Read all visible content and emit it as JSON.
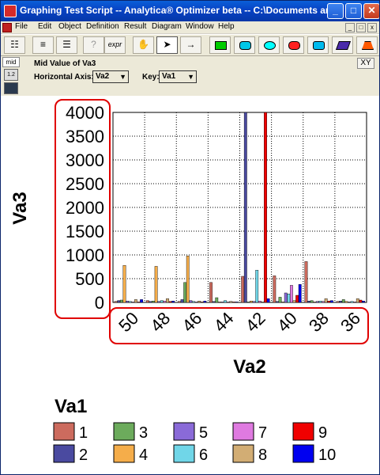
{
  "window": {
    "title": "Graphing Test Script -- Analytica® Optimizer beta -- C:\\Documents and Set...",
    "minimize_glyph": "_",
    "maximize_glyph": "□",
    "close_glyph": "✕"
  },
  "menu": {
    "items": [
      "File",
      "Edit",
      "Object",
      "Definition",
      "Result",
      "Diagram",
      "Window",
      "Help"
    ],
    "mdi_min": "_",
    "mdi_max": "□",
    "mdi_close": "x"
  },
  "toolbar": {
    "expr_label": "expr",
    "shape_colors": [
      "#00cc00",
      "#00c8e8",
      "#00ffff",
      "#ff2020",
      "#00bbee",
      "#4a2aaa",
      "#ff5a00"
    ]
  },
  "side": {
    "mid_label": "mid",
    "icon_table_label": "1.2",
    "icon_chart_label": "graph"
  },
  "controls": {
    "title": "Mid Value of Va3",
    "horizontal_axis_label": "Horizontal Axis:",
    "horizontal_axis_value": "Va2",
    "key_label": "Key:",
    "key_value": "Va1",
    "xy_label": "XY"
  },
  "chart_data": {
    "type": "bar",
    "ylabel": "Va3",
    "xlabel": "Va2",
    "ylim": [
      0,
      4000
    ],
    "yticks": [
      0,
      500,
      1000,
      1500,
      2000,
      2500,
      3000,
      3500,
      4000
    ],
    "categories": [
      "50",
      "48",
      "46",
      "44",
      "42",
      "40",
      "38",
      "36"
    ],
    "legend_title": "Va1",
    "grid": true,
    "annotation_color": "#e00000",
    "series": [
      {
        "name": "1",
        "color": "#cc6b5e",
        "values": [
          20,
          40,
          20,
          420,
          550,
          560,
          860,
          20
        ]
      },
      {
        "name": "2",
        "color": "#4a4aa0",
        "values": [
          40,
          20,
          60,
          20,
          4000,
          20,
          30,
          30
        ]
      },
      {
        "name": "3",
        "color": "#6cab5c",
        "values": [
          50,
          30,
          420,
          100,
          10,
          110,
          40,
          60
        ]
      },
      {
        "name": "4",
        "color": "#f5ad4a",
        "values": [
          780,
          760,
          980,
          10,
          30,
          10,
          10,
          20
        ]
      },
      {
        "name": "5",
        "color": "#8a6ad8",
        "values": [
          30,
          20,
          40,
          10,
          20,
          200,
          20,
          10
        ]
      },
      {
        "name": "6",
        "color": "#70d6e8",
        "values": [
          20,
          40,
          20,
          40,
          680,
          180,
          30,
          20
        ]
      },
      {
        "name": "7",
        "color": "#df7ae0",
        "values": [
          10,
          30,
          10,
          10,
          30,
          360,
          20,
          10
        ]
      },
      {
        "name": "8",
        "color": "#d2ad74",
        "values": [
          60,
          80,
          30,
          20,
          10,
          40,
          80,
          80
        ]
      },
      {
        "name": "9",
        "color": "#f00000",
        "values": [
          10,
          20,
          10,
          10,
          4000,
          150,
          30,
          50
        ]
      },
      {
        "name": "10",
        "color": "#0000f0",
        "values": [
          60,
          30,
          30,
          10,
          80,
          380,
          40,
          30
        ]
      }
    ]
  }
}
